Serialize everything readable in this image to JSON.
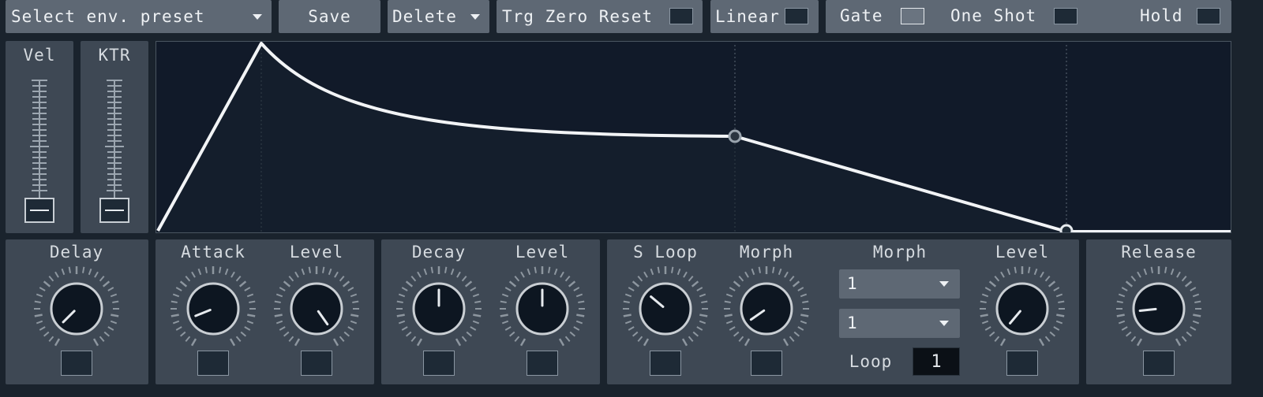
{
  "toolbar": {
    "preset_label": "Select env. preset",
    "save_label": "Save",
    "delete_label": "Delete",
    "trg_zero_reset_label": "Trg Zero Reset",
    "linear_label": "Linear",
    "gate_label": "Gate",
    "one_shot_label": "One Shot",
    "hold_label": "Hold"
  },
  "sliders": {
    "vel_label": "Vel",
    "ktr_label": "KTR"
  },
  "knobs": {
    "delay": "Delay",
    "attack": "Attack",
    "attack_level": "Level",
    "decay": "Decay",
    "decay_level": "Level",
    "s_loop": "S Loop",
    "morph": "Morph",
    "sustain_level": "Level",
    "release": "Release"
  },
  "morph_section": {
    "label": "Morph",
    "select1_value": "1",
    "select2_value": "1",
    "loop_label": "Loop",
    "loop_value": "1"
  },
  "colors": {
    "background": "#1a232d",
    "panel": "#3e4854",
    "button": "#5e6874",
    "graph_bg": "#111a29",
    "envelope_line": "#f2f4f6"
  }
}
